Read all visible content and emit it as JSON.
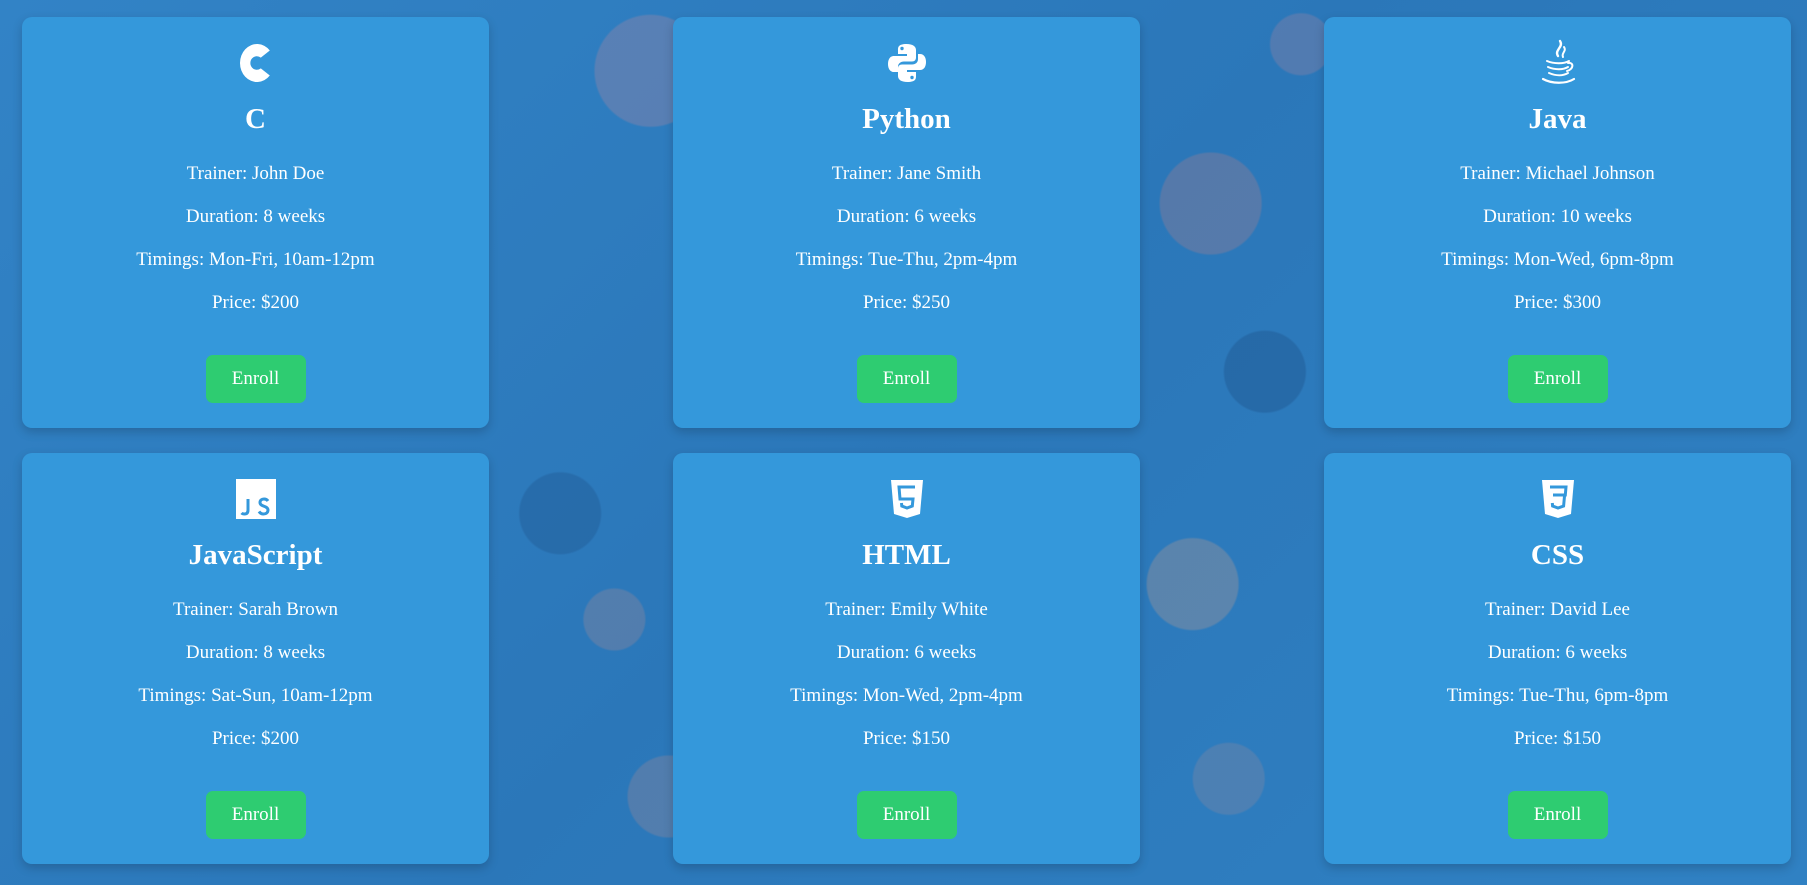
{
  "colors": {
    "card_bg": "#3498db",
    "button_bg": "#2ecc71",
    "text": "#ffffff",
    "page_bg": "#2f7cc0"
  },
  "courses": [
    {
      "icon": "c-language-icon",
      "title": "C",
      "trainer": "Trainer: John Doe",
      "duration": "Duration: 8 weeks",
      "timings": "Timings: Mon-Fri, 10am-12pm",
      "price": "Price: $200",
      "button": "Enroll"
    },
    {
      "icon": "python-icon",
      "title": "Python",
      "trainer": "Trainer: Jane Smith",
      "duration": "Duration: 6 weeks",
      "timings": "Timings: Tue-Thu, 2pm-4pm",
      "price": "Price: $250",
      "button": "Enroll"
    },
    {
      "icon": "java-icon",
      "title": "Java",
      "trainer": "Trainer: Michael Johnson",
      "duration": "Duration: 10 weeks",
      "timings": "Timings: Mon-Wed, 6pm-8pm",
      "price": "Price: $300",
      "button": "Enroll"
    },
    {
      "icon": "javascript-icon",
      "title": "JavaScript",
      "trainer": "Trainer: Sarah Brown",
      "duration": "Duration: 8 weeks",
      "timings": "Timings: Sat-Sun, 10am-12pm",
      "price": "Price: $200",
      "button": "Enroll"
    },
    {
      "icon": "html5-icon",
      "title": "HTML",
      "trainer": "Trainer: Emily White",
      "duration": "Duration: 6 weeks",
      "timings": "Timings: Mon-Wed, 2pm-4pm",
      "price": "Price: $150",
      "button": "Enroll"
    },
    {
      "icon": "css3-icon",
      "title": "CSS",
      "trainer": "Trainer: David Lee",
      "duration": "Duration: 6 weeks",
      "timings": "Timings: Tue-Thu, 6pm-8pm",
      "price": "Price: $150",
      "button": "Enroll"
    }
  ]
}
